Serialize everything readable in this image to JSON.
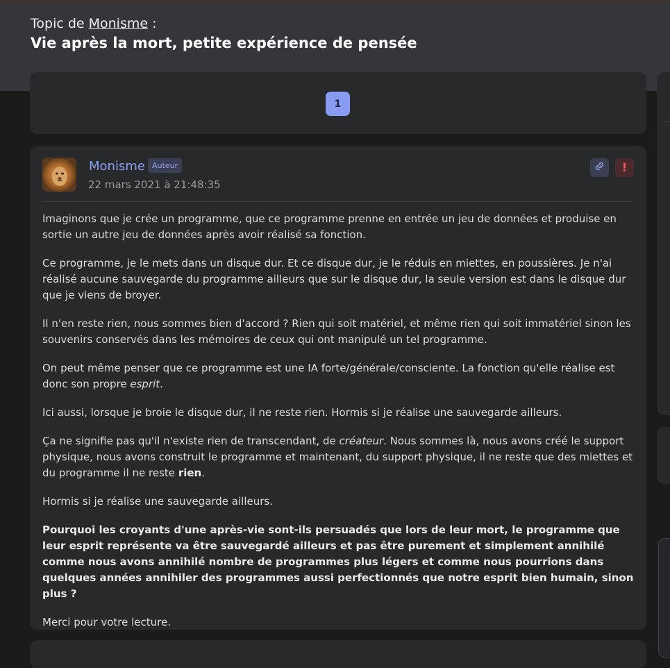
{
  "header": {
    "topic_prefix": "Topic de",
    "topic_author": "Monisme",
    "topic_suffix": " :",
    "title": "Vie après la mort, petite expérience de pensée"
  },
  "pagination": {
    "current_page": "1"
  },
  "post": {
    "author": "Monisme",
    "badge": "Auteur",
    "date": "22 mars 2021 à 21:48:35",
    "p1": "Imaginons que je crée un programme, que ce programme prenne en entrée un jeu de données et produise en sortie un autre jeu de données après avoir réalisé sa fonction.",
    "p2": "Ce programme, je le mets dans un disque dur. Et ce disque dur, je le réduis en miettes, en poussières. Je n'ai réalisé aucune sauvegarde du programme ailleurs que sur le disque dur, la seule version est dans le disque dur que je viens de broyer.",
    "p3": "Il n'en reste rien, nous sommes bien d'accord ? Rien qui soit matériel, et même rien qui soit immatériel sinon les souvenirs conservés dans les mémoires de ceux qui ont manipulé un tel programme.",
    "p4_start": "On peut même penser que ce programme est une IA forte/générale/consciente. La fonction qu'elle réalise est donc son propre ",
    "p4_em": "esprit",
    "p4_end": ".",
    "p5": "Ici aussi, lorsque je broie le disque dur, il ne reste rien. Hormis si je réalise une sauvegarde ailleurs.",
    "p6_start": "Ça ne signifie pas qu'il n'existe rien de transcendant, de ",
    "p6_em": "créateur",
    "p6_mid": ". Nous sommes là, nous avons créé le support physique, nous avons construit le programme et maintenant, du support physique, il ne reste que des miettes et du programme il ne reste ",
    "p6_strong": "rien",
    "p6_end": ".",
    "p7": "Hormis si je réalise une sauvegarde ailleurs.",
    "p8": "Pourquoi les croyants d'une après-vie sont-ils persuadés que lors de leur mort, le programme que leur esprit représente va être sauvegardé ailleurs et pas être purement et simplement annihilé comme nous avons annihilé nombre de programmes plus légers et comme nous pourrions dans quelques années annihiler des programmes aussi perfectionnés que notre esprit bien humain, sinon plus ?",
    "p9": "Merci pour votre lecture."
  },
  "icons": {
    "link": "link-icon",
    "alert": "alert-icon",
    "avatar": "lion-avatar"
  },
  "colors": {
    "accent": "#8a9cf2",
    "background": "#1b1b1c",
    "card": "#28292b",
    "header_band": "#34363b",
    "alert": "#f25a5a"
  }
}
